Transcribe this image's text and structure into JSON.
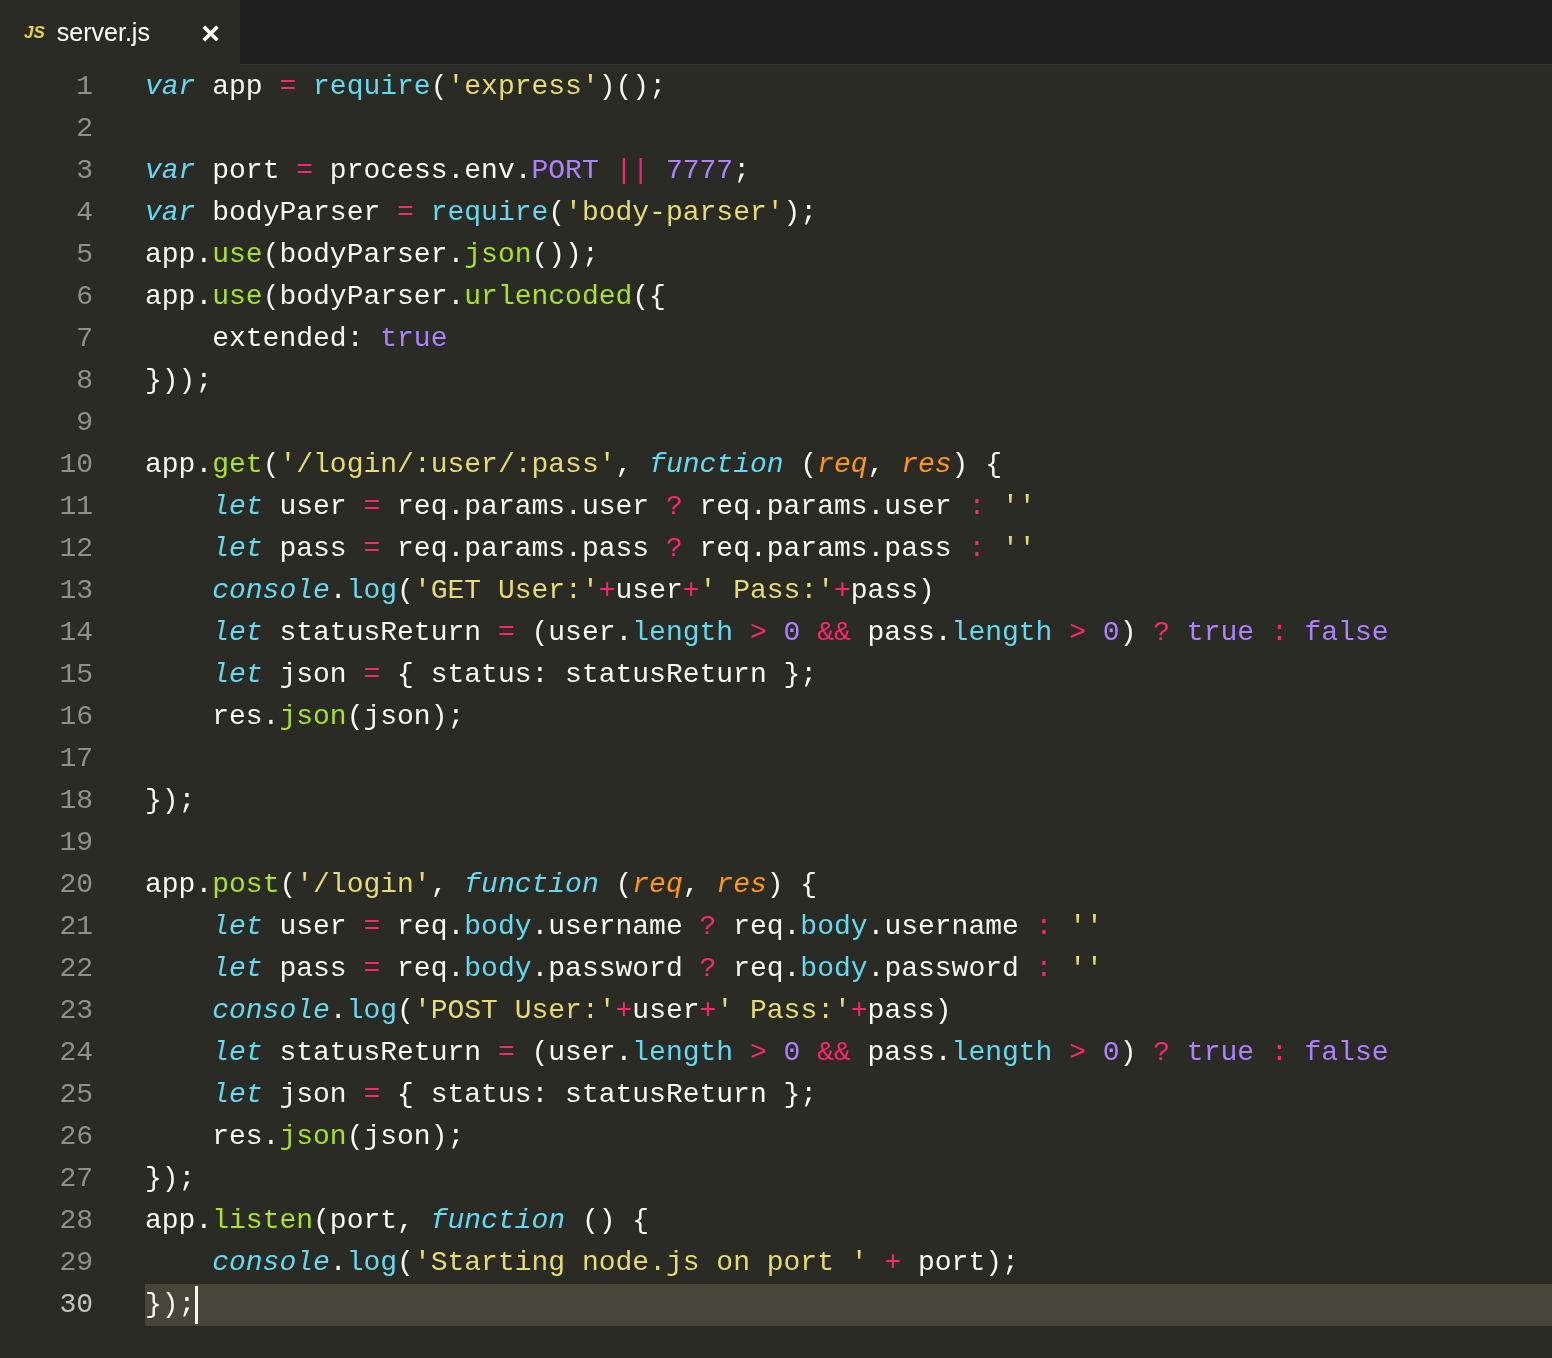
{
  "tab": {
    "badge": "JS",
    "label": "server.js",
    "close": "×",
    "selected": true
  },
  "lines": [
    {
      "number": "1",
      "current": false,
      "tokens": [
        {
          "kind": "keyword",
          "text": "var"
        },
        {
          "kind": "plain",
          "text": " app "
        },
        {
          "kind": "op",
          "text": "= "
        },
        {
          "kind": "support",
          "text": "require"
        },
        {
          "kind": "plain",
          "text": "("
        },
        {
          "kind": "string",
          "text": "'express'"
        },
        {
          "kind": "plain",
          "text": ")();"
        }
      ]
    },
    {
      "number": "2",
      "current": false
    },
    {
      "number": "3",
      "current": false,
      "tokens": [
        {
          "kind": "keyword",
          "text": "var"
        },
        {
          "kind": "plain",
          "text": " port "
        },
        {
          "kind": "op",
          "text": "="
        },
        {
          "kind": "plain",
          "text": " process.env."
        },
        {
          "kind": "constant",
          "text": "PORT "
        },
        {
          "kind": "op",
          "text": "|| "
        },
        {
          "kind": "constant",
          "text": "7777"
        },
        {
          "kind": "plain",
          "text": ";"
        }
      ]
    },
    {
      "number": "4",
      "current": false,
      "tokens": [
        {
          "kind": "keyword",
          "text": "var"
        },
        {
          "kind": "plain",
          "text": " bodyParser "
        },
        {
          "kind": "op",
          "text": "= "
        },
        {
          "kind": "support",
          "text": "require"
        },
        {
          "kind": "plain",
          "text": "("
        },
        {
          "kind": "string",
          "text": "'body-parser'"
        },
        {
          "kind": "plain",
          "text": ");"
        }
      ]
    },
    {
      "number": "5",
      "current": false,
      "tokens": [
        {
          "kind": "plain",
          "text": "app."
        },
        {
          "kind": "call",
          "text": "use"
        },
        {
          "kind": "plain",
          "text": "(bodyParser."
        },
        {
          "kind": "call",
          "text": "json"
        },
        {
          "kind": "plain",
          "text": "());"
        }
      ]
    },
    {
      "number": "6",
      "current": false,
      "tokens": [
        {
          "kind": "plain",
          "text": "app."
        },
        {
          "kind": "call",
          "text": "use"
        },
        {
          "kind": "plain",
          "text": "(bodyParser."
        },
        {
          "kind": "call",
          "text": "urlencoded"
        },
        {
          "kind": "plain",
          "text": "({"
        }
      ]
    },
    {
      "number": "7",
      "current": false,
      "tokens": [
        {
          "kind": "plain",
          "text": "    extended: "
        },
        {
          "kind": "constant",
          "text": "true"
        }
      ]
    },
    {
      "number": "8",
      "current": false,
      "tokens": [
        {
          "kind": "plain",
          "text": "}));"
        }
      ]
    },
    {
      "number": "9",
      "current": false
    },
    {
      "number": "10",
      "current": false,
      "tokens": [
        {
          "kind": "plain",
          "text": "app."
        },
        {
          "kind": "call",
          "text": "get"
        },
        {
          "kind": "plain",
          "text": "("
        },
        {
          "kind": "string",
          "text": "'/login/:user/:pass'"
        },
        {
          "kind": "plain",
          "text": ", "
        },
        {
          "kind": "keyword",
          "text": "function"
        },
        {
          "kind": "plain",
          "text": " ("
        },
        {
          "kind": "param",
          "text": "req"
        },
        {
          "kind": "plain",
          "text": ", "
        },
        {
          "kind": "param",
          "text": "res"
        },
        {
          "kind": "plain",
          "text": ") {"
        }
      ]
    },
    {
      "number": "11",
      "current": false,
      "tokens": [
        {
          "kind": "keyword",
          "text": "    let"
        },
        {
          "kind": "plain",
          "text": " user "
        },
        {
          "kind": "op",
          "text": "="
        },
        {
          "kind": "plain",
          "text": " req.params.user "
        },
        {
          "kind": "op",
          "text": "?"
        },
        {
          "kind": "plain",
          "text": " req.params.user "
        },
        {
          "kind": "op",
          "text": ": "
        },
        {
          "kind": "string",
          "text": "''"
        }
      ]
    },
    {
      "number": "12",
      "current": false,
      "tokens": [
        {
          "kind": "keyword",
          "text": "    let"
        },
        {
          "kind": "plain",
          "text": " pass "
        },
        {
          "kind": "op",
          "text": "="
        },
        {
          "kind": "plain",
          "text": " req.params.pass "
        },
        {
          "kind": "op",
          "text": "?"
        },
        {
          "kind": "plain",
          "text": " req.params.pass "
        },
        {
          "kind": "op",
          "text": ": "
        },
        {
          "kind": "string",
          "text": "''"
        }
      ]
    },
    {
      "number": "13",
      "current": false,
      "tokens": [
        {
          "kind": "keyword",
          "text": "    console"
        },
        {
          "kind": "plain",
          "text": "."
        },
        {
          "kind": "support",
          "text": "log"
        },
        {
          "kind": "plain",
          "text": "("
        },
        {
          "kind": "string",
          "text": "'GET User:'"
        },
        {
          "kind": "op",
          "text": "+"
        },
        {
          "kind": "plain",
          "text": "user"
        },
        {
          "kind": "op",
          "text": "+"
        },
        {
          "kind": "string",
          "text": "' Pass:'"
        },
        {
          "kind": "op",
          "text": "+"
        },
        {
          "kind": "plain",
          "text": "pass)"
        }
      ]
    },
    {
      "number": "14",
      "current": false,
      "tokens": [
        {
          "kind": "keyword",
          "text": "    let"
        },
        {
          "kind": "plain",
          "text": " statusReturn "
        },
        {
          "kind": "op",
          "text": "="
        },
        {
          "kind": "plain",
          "text": " (user."
        },
        {
          "kind": "support",
          "text": "length "
        },
        {
          "kind": "op",
          "text": "> "
        },
        {
          "kind": "constant",
          "text": "0 "
        },
        {
          "kind": "op",
          "text": "&&"
        },
        {
          "kind": "plain",
          "text": " pass."
        },
        {
          "kind": "support",
          "text": "length "
        },
        {
          "kind": "op",
          "text": "> "
        },
        {
          "kind": "constant",
          "text": "0"
        },
        {
          "kind": "plain",
          "text": ") "
        },
        {
          "kind": "op",
          "text": "? "
        },
        {
          "kind": "constant",
          "text": "true "
        },
        {
          "kind": "op",
          "text": ": "
        },
        {
          "kind": "constant",
          "text": "false"
        }
      ]
    },
    {
      "number": "15",
      "current": false,
      "tokens": [
        {
          "kind": "keyword",
          "text": "    let"
        },
        {
          "kind": "plain",
          "text": " json "
        },
        {
          "kind": "op",
          "text": "="
        },
        {
          "kind": "plain",
          "text": " { status: statusReturn };"
        }
      ]
    },
    {
      "number": "16",
      "current": false,
      "tokens": [
        {
          "kind": "plain",
          "text": "    res."
        },
        {
          "kind": "call",
          "text": "json"
        },
        {
          "kind": "plain",
          "text": "(json);"
        }
      ]
    },
    {
      "number": "17",
      "current": false
    },
    {
      "number": "18",
      "current": false,
      "tokens": [
        {
          "kind": "plain",
          "text": "});"
        }
      ]
    },
    {
      "number": "19",
      "current": false
    },
    {
      "number": "20",
      "current": false,
      "tokens": [
        {
          "kind": "plain",
          "text": "app."
        },
        {
          "kind": "call",
          "text": "post"
        },
        {
          "kind": "plain",
          "text": "("
        },
        {
          "kind": "string",
          "text": "'/login'"
        },
        {
          "kind": "plain",
          "text": ", "
        },
        {
          "kind": "keyword",
          "text": "function"
        },
        {
          "kind": "plain",
          "text": " ("
        },
        {
          "kind": "param",
          "text": "req"
        },
        {
          "kind": "plain",
          "text": ", "
        },
        {
          "kind": "param",
          "text": "res"
        },
        {
          "kind": "plain",
          "text": ") {"
        }
      ]
    },
    {
      "number": "21",
      "current": false,
      "tokens": [
        {
          "kind": "keyword",
          "text": "    let"
        },
        {
          "kind": "plain",
          "text": " user "
        },
        {
          "kind": "op",
          "text": "="
        },
        {
          "kind": "plain",
          "text": " req."
        },
        {
          "kind": "support",
          "text": "body"
        },
        {
          "kind": "plain",
          "text": ".username "
        },
        {
          "kind": "op",
          "text": "?"
        },
        {
          "kind": "plain",
          "text": " req."
        },
        {
          "kind": "support",
          "text": "body"
        },
        {
          "kind": "plain",
          "text": ".username "
        },
        {
          "kind": "op",
          "text": ": "
        },
        {
          "kind": "string",
          "text": "''"
        }
      ]
    },
    {
      "number": "22",
      "current": false,
      "tokens": [
        {
          "kind": "keyword",
          "text": "    let"
        },
        {
          "kind": "plain",
          "text": " pass "
        },
        {
          "kind": "op",
          "text": "="
        },
        {
          "kind": "plain",
          "text": " req."
        },
        {
          "kind": "support",
          "text": "body"
        },
        {
          "kind": "plain",
          "text": ".password "
        },
        {
          "kind": "op",
          "text": "?"
        },
        {
          "kind": "plain",
          "text": " req."
        },
        {
          "kind": "support",
          "text": "body"
        },
        {
          "kind": "plain",
          "text": ".password "
        },
        {
          "kind": "op",
          "text": ": "
        },
        {
          "kind": "string",
          "text": "''"
        }
      ]
    },
    {
      "number": "23",
      "current": false,
      "tokens": [
        {
          "kind": "keyword",
          "text": "    console"
        },
        {
          "kind": "plain",
          "text": "."
        },
        {
          "kind": "support",
          "text": "log"
        },
        {
          "kind": "plain",
          "text": "("
        },
        {
          "kind": "string",
          "text": "'POST User:'"
        },
        {
          "kind": "op",
          "text": "+"
        },
        {
          "kind": "plain",
          "text": "user"
        },
        {
          "kind": "op",
          "text": "+"
        },
        {
          "kind": "string",
          "text": "' Pass:'"
        },
        {
          "kind": "op",
          "text": "+"
        },
        {
          "kind": "plain",
          "text": "pass)"
        }
      ]
    },
    {
      "number": "24",
      "current": false,
      "tokens": [
        {
          "kind": "keyword",
          "text": "    let"
        },
        {
          "kind": "plain",
          "text": " statusReturn "
        },
        {
          "kind": "op",
          "text": "="
        },
        {
          "kind": "plain",
          "text": " (user."
        },
        {
          "kind": "support",
          "text": "length "
        },
        {
          "kind": "op",
          "text": "> "
        },
        {
          "kind": "constant",
          "text": "0 "
        },
        {
          "kind": "op",
          "text": "&&"
        },
        {
          "kind": "plain",
          "text": " pass."
        },
        {
          "kind": "support",
          "text": "length "
        },
        {
          "kind": "op",
          "text": "> "
        },
        {
          "kind": "constant",
          "text": "0"
        },
        {
          "kind": "plain",
          "text": ") "
        },
        {
          "kind": "op",
          "text": "? "
        },
        {
          "kind": "constant",
          "text": "true "
        },
        {
          "kind": "op",
          "text": ": "
        },
        {
          "kind": "constant",
          "text": "false"
        }
      ]
    },
    {
      "number": "25",
      "current": false,
      "tokens": [
        {
          "kind": "keyword",
          "text": "    let"
        },
        {
          "kind": "plain",
          "text": " json "
        },
        {
          "kind": "op",
          "text": "="
        },
        {
          "kind": "plain",
          "text": " { status: statusReturn };"
        }
      ]
    },
    {
      "number": "26",
      "current": false,
      "tokens": [
        {
          "kind": "plain",
          "text": "    res."
        },
        {
          "kind": "call",
          "text": "json"
        },
        {
          "kind": "plain",
          "text": "(json);"
        }
      ]
    },
    {
      "number": "27",
      "current": false,
      "tokens": [
        {
          "kind": "plain",
          "text": "});"
        }
      ]
    },
    {
      "number": "28",
      "current": false,
      "tokens": [
        {
          "kind": "plain",
          "text": "app."
        },
        {
          "kind": "call",
          "text": "listen"
        },
        {
          "kind": "plain",
          "text": "(port, "
        },
        {
          "kind": "keyword",
          "text": "function"
        },
        {
          "kind": "plain",
          "text": " () {"
        }
      ]
    },
    {
      "number": "29",
      "current": false,
      "tokens": [
        {
          "kind": "keyword",
          "text": "    console"
        },
        {
          "kind": "plain",
          "text": "."
        },
        {
          "kind": "support",
          "text": "log"
        },
        {
          "kind": "plain",
          "text": "("
        },
        {
          "kind": "string",
          "text": "'Starting node.js on port ' "
        },
        {
          "kind": "op",
          "text": "+"
        },
        {
          "kind": "plain",
          "text": " port);"
        }
      ]
    },
    {
      "number": "30",
      "current": true,
      "tokens": [
        {
          "kind": "plain",
          "text": "});"
        }
      ]
    }
  ]
}
